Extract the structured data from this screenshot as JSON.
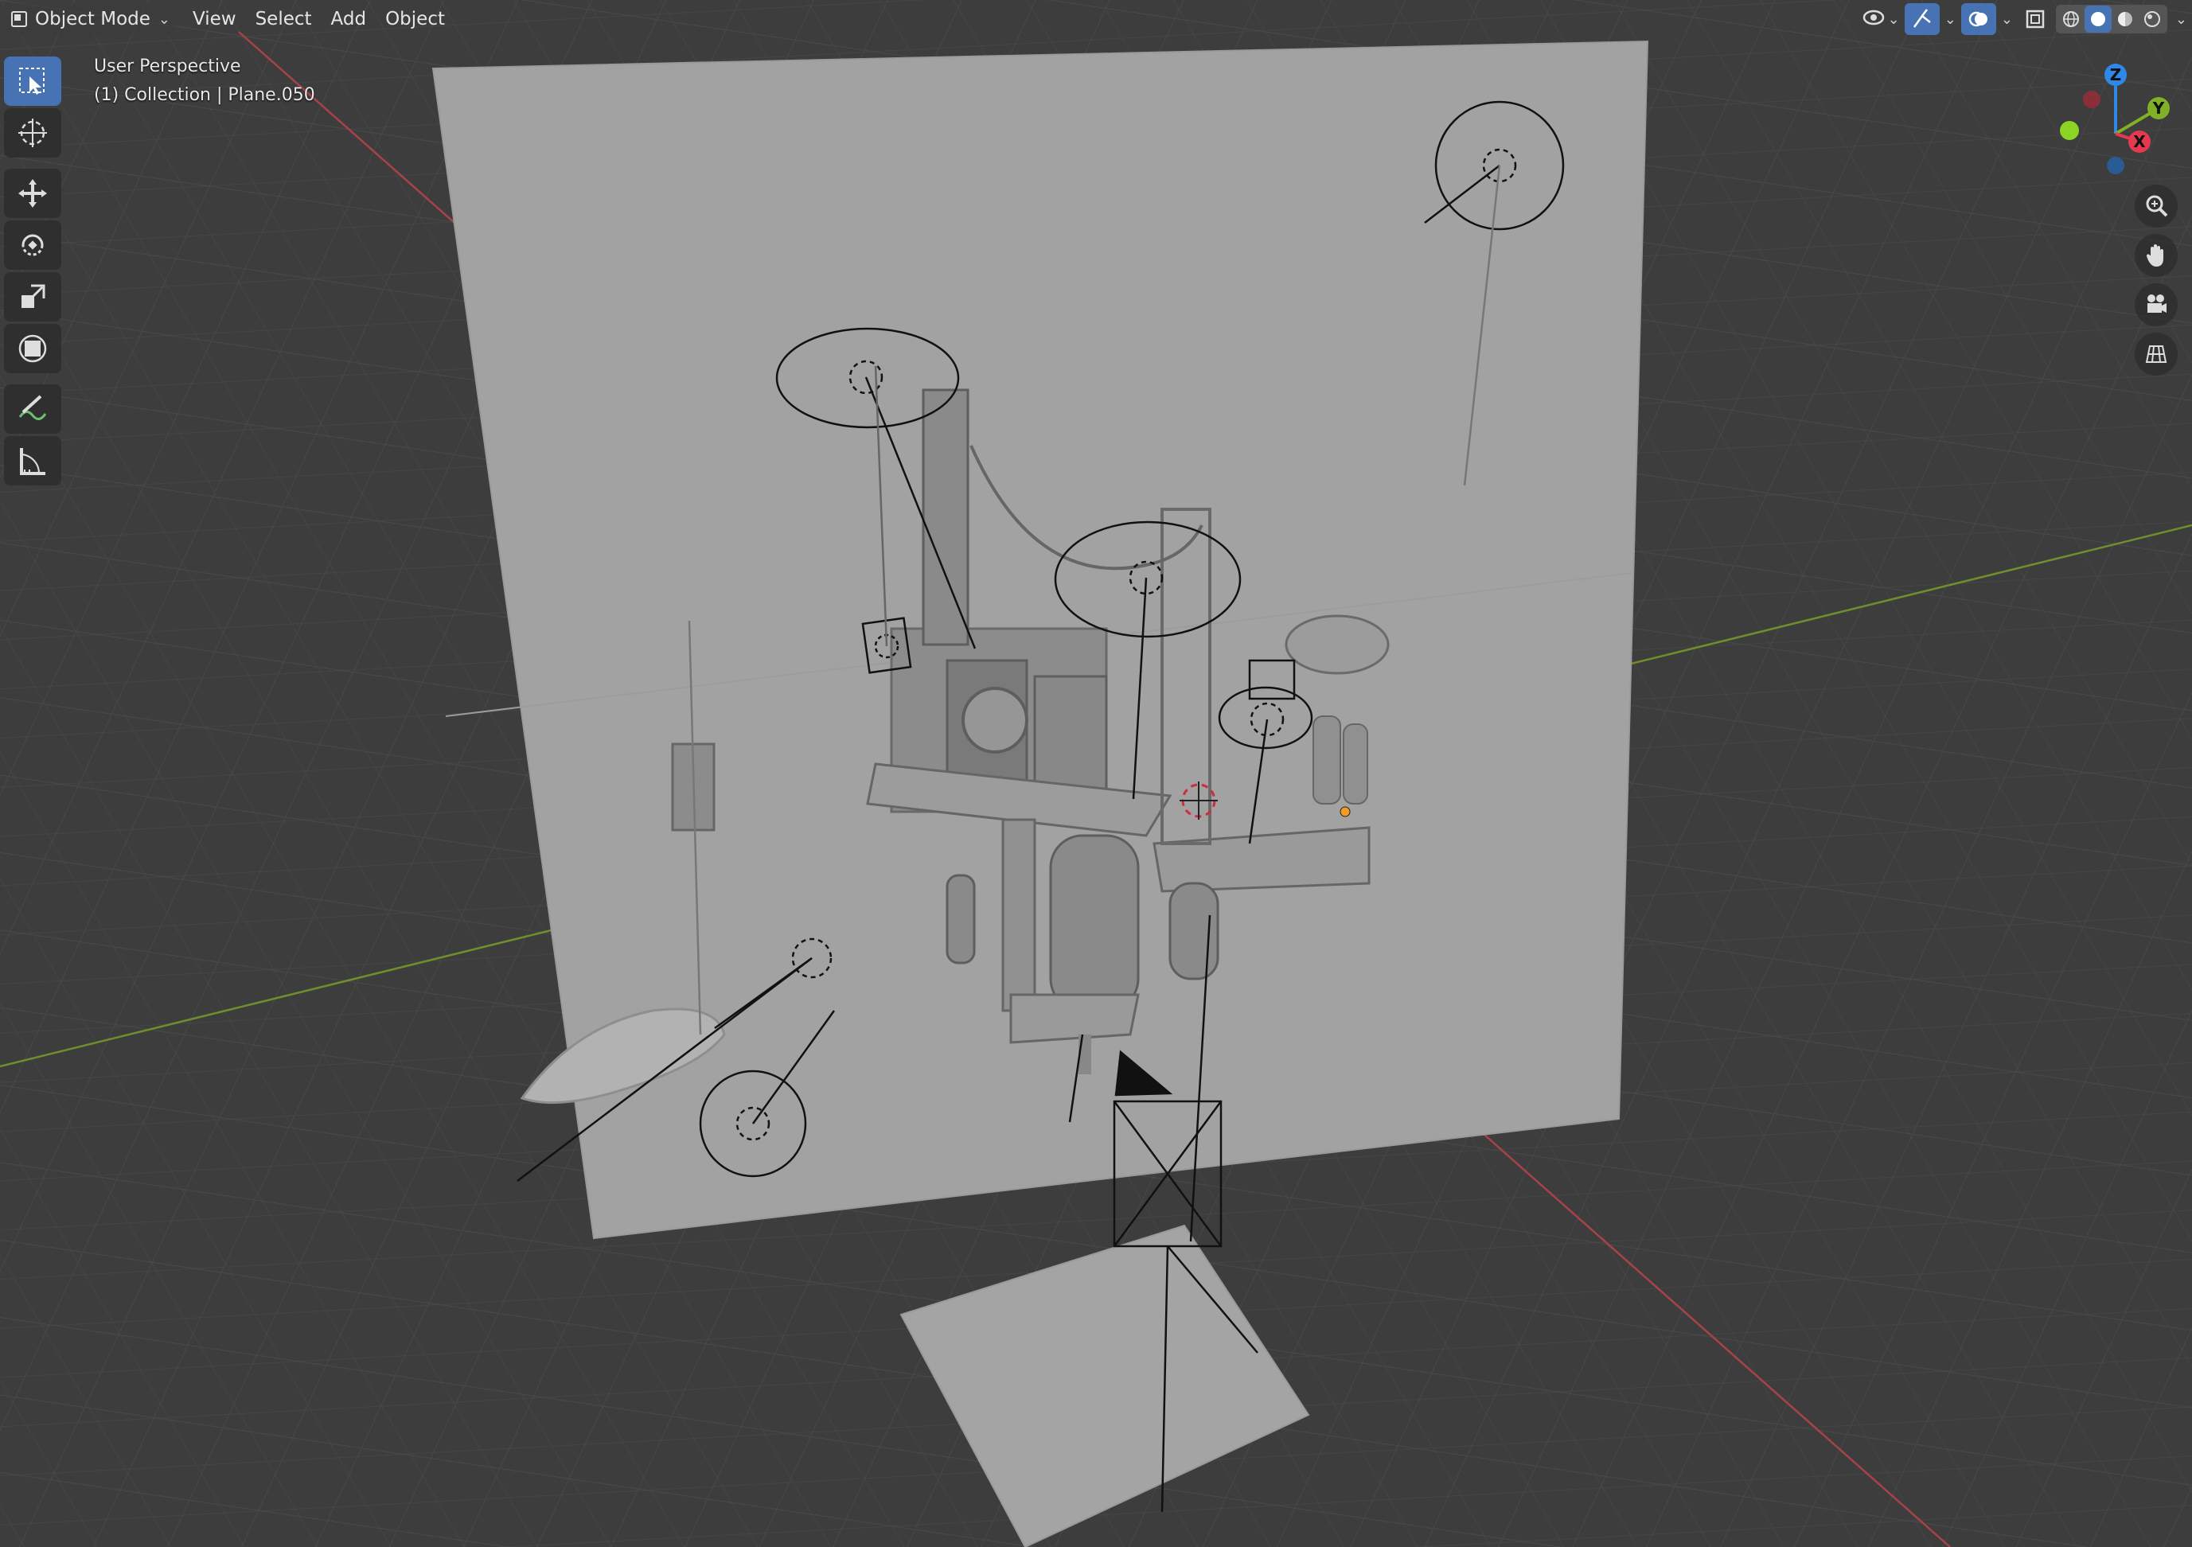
{
  "header": {
    "mode": "Object Mode",
    "menus": [
      "View",
      "Select",
      "Add",
      "Object"
    ]
  },
  "viewport": {
    "perspective_label": "User Perspective",
    "context_label": "(1) Collection | Plane.050"
  },
  "gizmo": {
    "z": "Z",
    "y": "Y",
    "x": "X",
    "colors": {
      "x": "#e5394f",
      "y": "#7fb026",
      "z": "#2f87e8"
    }
  },
  "toolbar": {
    "tools": [
      "select-box-icon",
      "cursor-icon",
      "move-icon",
      "rotate-icon",
      "scale-icon",
      "transform-icon",
      "annotate-icon",
      "measure-icon"
    ]
  },
  "colors": {
    "accent": "#4772b3",
    "background": "#3d3d3d",
    "backdrop_plane": "#a3a3a3"
  }
}
